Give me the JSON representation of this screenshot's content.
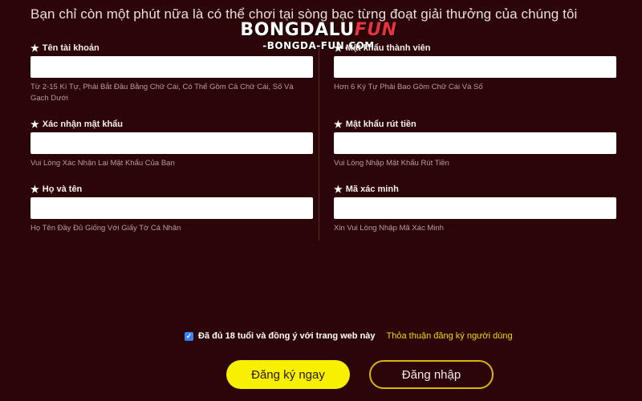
{
  "headline": "Bạn chỉ còn một phút nữa là có thể chơi tại sòng bạc từng đoạt giải thưởng của chúng tôi",
  "watermark": {
    "part1": "BONG",
    "part2": "DALU",
    "part3": "FUN",
    "sub": "-BONGDA-FUN.COM"
  },
  "fields": {
    "username": {
      "label": "Tên tài khoản",
      "value": "",
      "hint": "Từ 2-15 Kí Tự, Phải Bắt Đầu Bằng Chữ Cái, Có Thể Gồm Cả Chữ Cái, Số Và Gạch Dưới"
    },
    "member_password": {
      "label": "Mật khẩu thành viên",
      "value": "",
      "hint": "Hơn 6 Ký Tự Phải Bao Gồm Chữ Cái Và Số"
    },
    "confirm_password": {
      "label": "Xác nhận mật khẩu",
      "value": "",
      "hint": "Vui Lòng Xác Nhận Lại Mật Khẩu Của Bạn"
    },
    "withdraw_password": {
      "label": "Mật khẩu rút tiền",
      "value": "",
      "hint": "Vui Lòng Nhập Mật Khẩu Rút Tiền"
    },
    "full_name": {
      "label": "Họ và tên",
      "value": "",
      "hint": "Họ Tên Đầy Đủ Giống Với Giấy Tờ Cá Nhân"
    },
    "verify_code": {
      "label": "Mã xác minh",
      "value": "",
      "hint": "Xin Vui Lòng Nhập Mã Xác Minh"
    }
  },
  "agreement": {
    "checked": true,
    "text": "Đã đủ 18 tuổi và đồng ý với trang web này",
    "link": "Thỏa thuận đăng ký người dùng"
  },
  "buttons": {
    "register": "Đăng ký ngay",
    "login": "Đăng nhập"
  },
  "icons": {
    "required": "star-icon",
    "check": "check-icon"
  },
  "colors": {
    "background": "#2c0508",
    "primary_button": "#f8f001",
    "link": "#f2d900",
    "checkbox": "#3b82f6"
  }
}
